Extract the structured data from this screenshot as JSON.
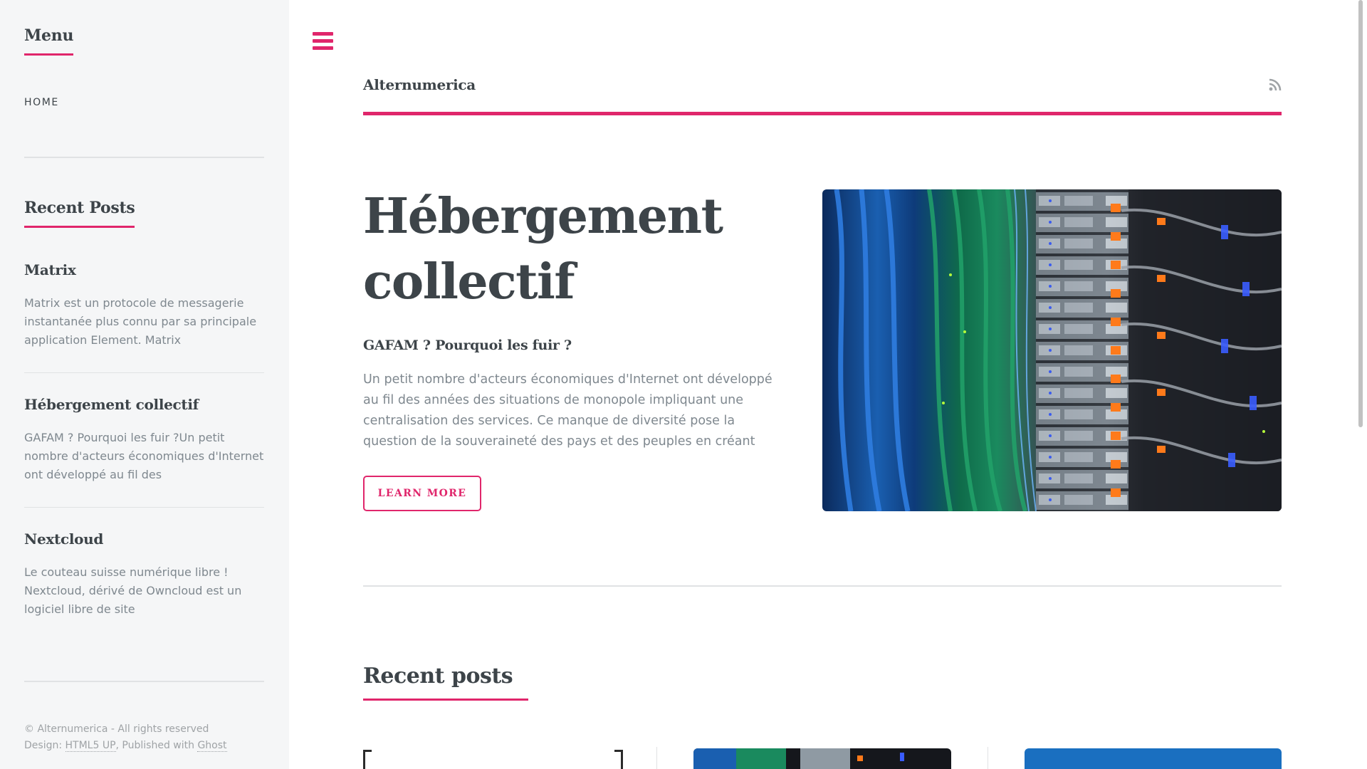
{
  "sidebar": {
    "menu_heading": "Menu",
    "menu_items": [
      {
        "label": "HOME"
      }
    ],
    "recent_heading": "Recent Posts",
    "posts": [
      {
        "title": "Matrix",
        "excerpt": "Matrix est un protocole de messagerie instantanée plus connu par sa principale application Element. Matrix"
      },
      {
        "title": "Hébergement collectif",
        "excerpt": "GAFAM ? Pourquoi les fuir ?Un petit nombre d'acteurs économiques d'Internet ont développé au fil des"
      },
      {
        "title": "Nextcloud",
        "excerpt": "Le couteau suisse numérique libre ! Nextcloud, dérivé de Owncloud est un logiciel libre de site"
      }
    ],
    "footer": {
      "copyright": "© Alternumerica - All rights reserved",
      "design_prefix": "Design: ",
      "design_link": "HTML5 UP",
      "published_prefix": ", Published with ",
      "published_link": "Ghost"
    }
  },
  "header": {
    "site_name": "Alternumerica",
    "rss_icon": "rss-icon",
    "menu_icon": "hamburger-menu-icon"
  },
  "banner": {
    "title": "Hébergement collectif",
    "subtitle": "GAFAM ? Pourquoi les fuir ?",
    "text": "Un petit nombre d'acteurs économiques d'Internet ont développé au fil des années des situations de monopole impliquant une centralisation des services. Ce manque de diversité pose la question de la souveraineté des pays et des peuples en créant",
    "button_label": "Learn More",
    "image_alt": "server rack with network cables"
  },
  "recent_posts": {
    "heading": "Recent posts"
  },
  "colors": {
    "accent": "#e0266b",
    "text": "#3d4449",
    "muted": "#7f888f",
    "sidebar_bg": "#f5f6f7"
  }
}
